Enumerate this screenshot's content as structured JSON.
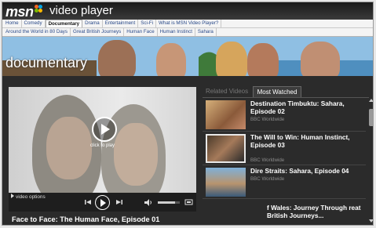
{
  "header": {
    "logo_text": "msn",
    "app_title": "video player"
  },
  "nav": {
    "categories": [
      "Home",
      "Comedy",
      "Documentary",
      "Drama",
      "Entertainment",
      "Sci-Fi",
      "What is MSN Video Player?"
    ],
    "active_category": "Documentary",
    "series": [
      "Around the World in 80 Days",
      "Great British Journeys",
      "Human Face",
      "Human Instinct",
      "Sahara"
    ]
  },
  "banner": {
    "title": "documentary"
  },
  "player": {
    "overlay_text": "click to play",
    "options_label": "video options",
    "volume_level": 0.8,
    "episode_title": "Face to Face: The Human Face, Episode 01"
  },
  "sidebar": {
    "tabs": [
      "Related Videos",
      "Most Watched"
    ],
    "active_tab": "Most Watched",
    "items": [
      {
        "title": "Destination Timbuktu: Sahara, Episode 02",
        "source": "BBC Worldwide"
      },
      {
        "title": "The Will to Win: Human Instinct, Episode 03",
        "source": "BBC Worldwide"
      },
      {
        "title": "Dire Straits: Sahara, Episode 04",
        "source": "BBC Worldwide"
      },
      {
        "title": "f Wales: Journey Through reat British Journeys...",
        "source": ""
      }
    ]
  },
  "icons": {
    "play": "play-icon",
    "prev": "previous-icon",
    "next": "next-icon",
    "volume": "volume-icon",
    "fullscreen": "fullscreen-icon"
  },
  "colors": {
    "background": "#2b2b2b",
    "nav_link": "#2a4a8a",
    "text_primary": "#ffffff",
    "text_secondary": "#8a8a8a"
  }
}
